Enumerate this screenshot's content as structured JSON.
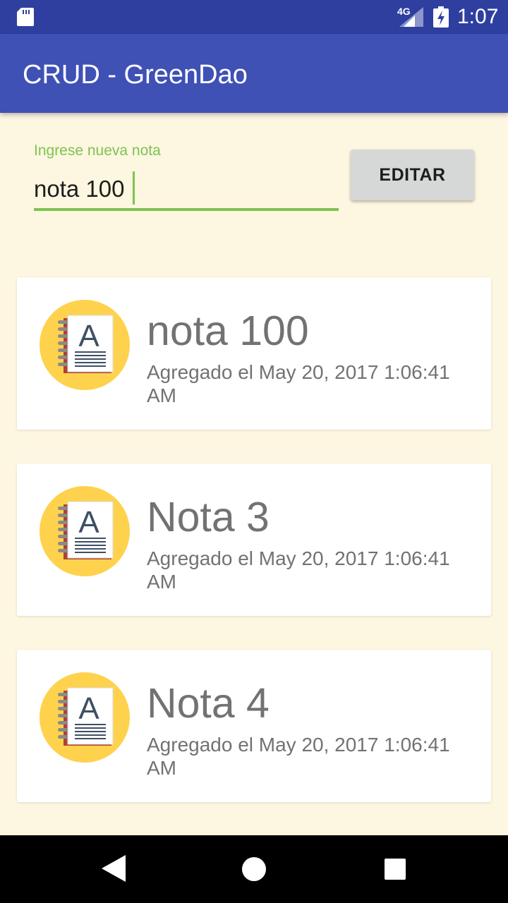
{
  "status_bar": {
    "network": "4G",
    "time": "1:07",
    "icons": [
      "sd-card-icon",
      "signal-icon",
      "battery-charging-icon"
    ]
  },
  "app_bar": {
    "title": "CRUD - GreenDao",
    "color": "#3f51b5"
  },
  "form": {
    "label": "Ingrese nueva nota",
    "value": "nota 100",
    "button_label": "EDITAR",
    "accent": "#7cc450"
  },
  "notes": [
    {
      "title": "nota 100",
      "date": "Agregado el May 20, 2017 1:06:41 AM",
      "icon": "notebook-icon"
    },
    {
      "title": "Nota 3",
      "date": "Agregado el May 20, 2017 1:06:41 AM",
      "icon": "notebook-icon"
    },
    {
      "title": "Nota 4",
      "date": "Agregado el May 20, 2017 1:06:41 AM",
      "icon": "notebook-icon"
    }
  ],
  "nav_bar": {
    "icons": [
      "back-icon",
      "home-icon",
      "recents-icon"
    ]
  },
  "colors": {
    "background": "#fdf6e0",
    "status_bar": "#2f3f9f",
    "card": "#ffffff",
    "icon_circle": "#ffd24d",
    "text_secondary": "#727272"
  }
}
